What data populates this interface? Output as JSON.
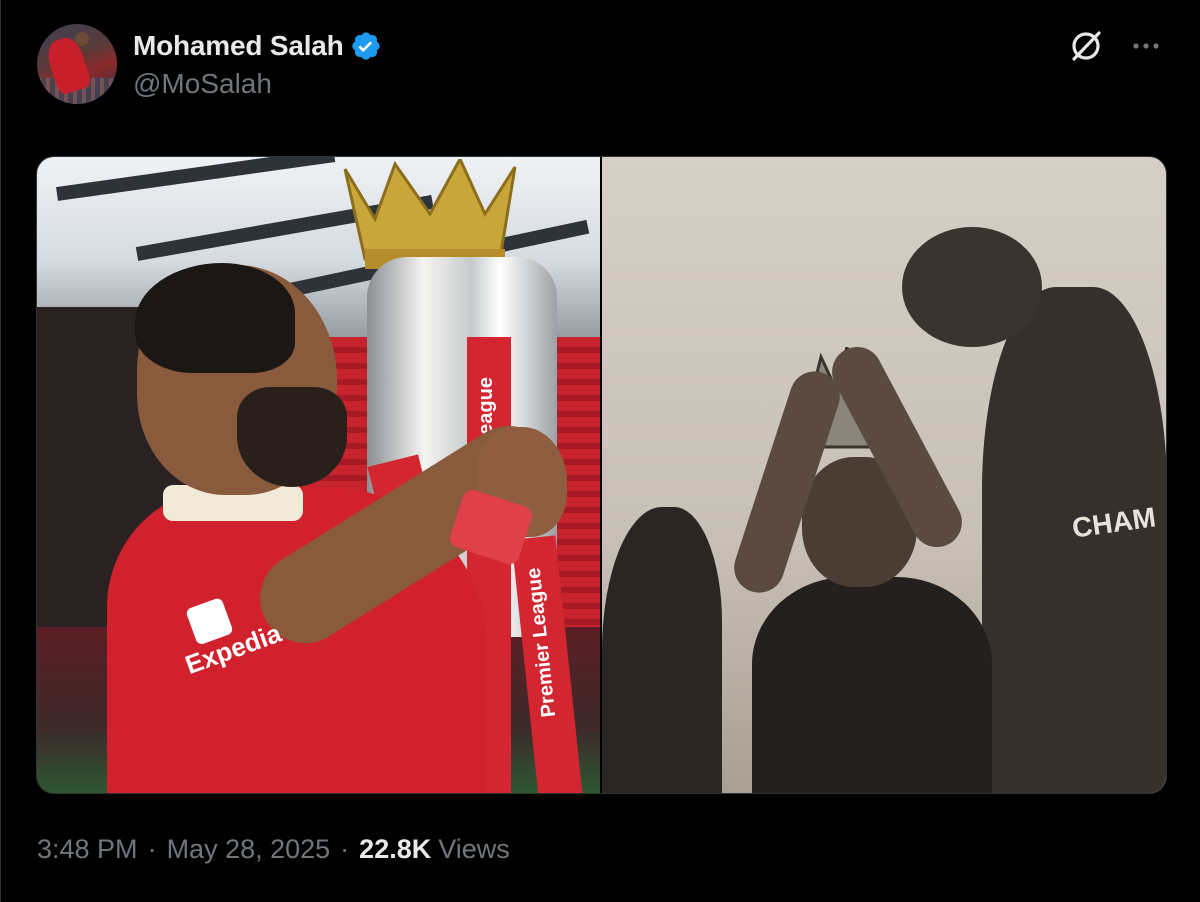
{
  "author": {
    "display_name": "Mohamed Salah",
    "handle": "@MoSalah",
    "verified": true,
    "verified_color": "#1d9bf0"
  },
  "actions": {
    "grok_icon": "grok-icon",
    "more_icon": "more-icon"
  },
  "media": {
    "left_photo": {
      "sponsor": "Expedia",
      "ribbon_text": "Premier League"
    },
    "right_photo": {
      "shirt_text": "CHAM"
    }
  },
  "meta": {
    "time": "3:48 PM",
    "separator": "·",
    "date": "May 28, 2025",
    "views_count": "22.8K",
    "views_label": "Views"
  },
  "colors": {
    "background": "#000000",
    "text_primary": "#e7e9ea",
    "text_secondary": "#71767b",
    "border": "#2f3336"
  }
}
